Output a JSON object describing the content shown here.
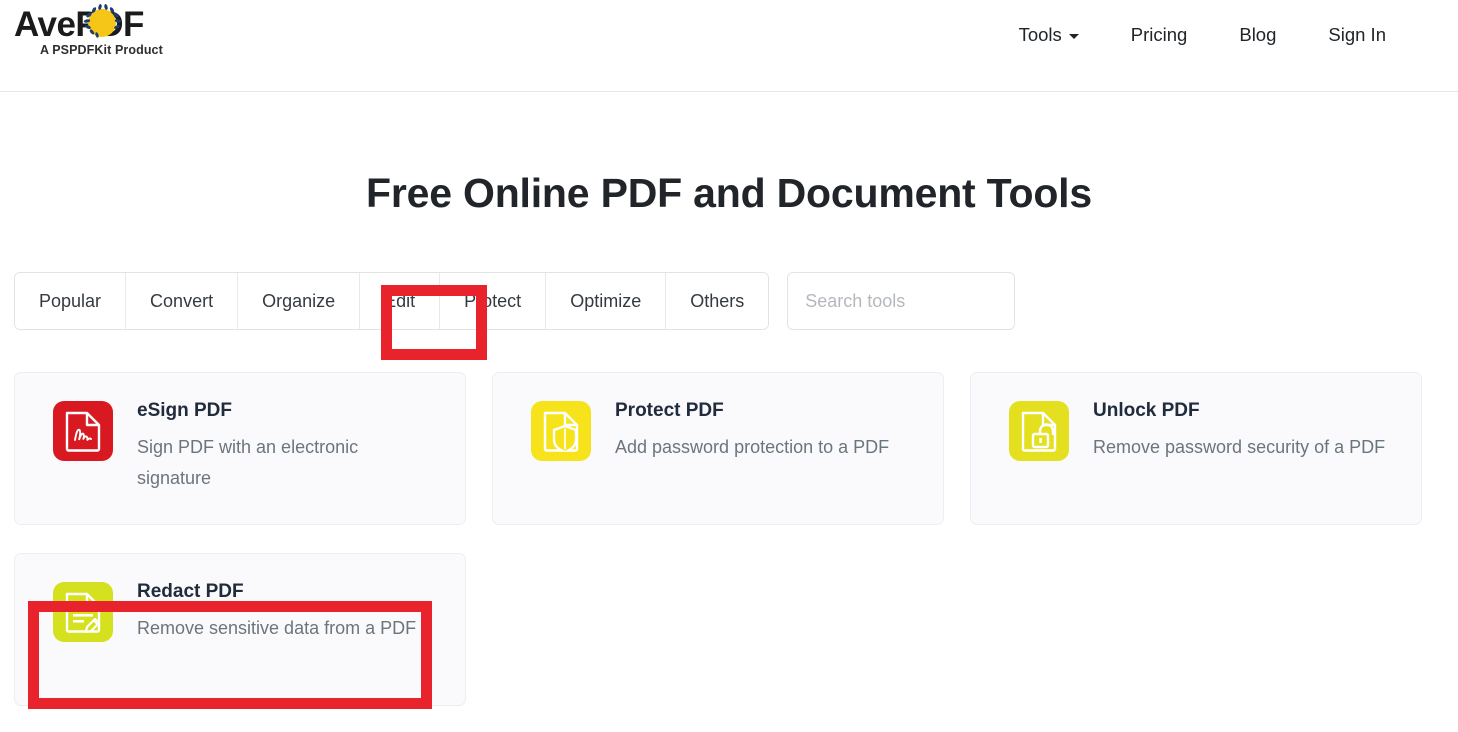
{
  "header": {
    "logo": {
      "text_ave": "Av",
      "text_e": "e",
      "text_pdf": "PDF",
      "tagline": "A PSPDFKit Product"
    },
    "nav": [
      {
        "label": "Tools",
        "has_dropdown": true
      },
      {
        "label": "Pricing",
        "has_dropdown": false
      },
      {
        "label": "Blog",
        "has_dropdown": false
      },
      {
        "label": "Sign In",
        "has_dropdown": false
      }
    ]
  },
  "main": {
    "title": "Free Online PDF and Document Tools",
    "tabs": [
      {
        "label": "Popular",
        "highlighted": false
      },
      {
        "label": "Convert",
        "highlighted": false
      },
      {
        "label": "Organize",
        "highlighted": false
      },
      {
        "label": "Edit",
        "highlighted": false
      },
      {
        "label": "Protect",
        "highlighted": true
      },
      {
        "label": "Optimize",
        "highlighted": false
      },
      {
        "label": "Others",
        "highlighted": false
      }
    ],
    "search": {
      "placeholder": "Search tools",
      "value": ""
    },
    "cards": [
      {
        "title": "eSign PDF",
        "description": "Sign PDF with an electronic signature",
        "icon": "document-signature-icon",
        "icon_bg": "#D81921",
        "highlighted": false
      },
      {
        "title": "Protect PDF",
        "description": "Add password protection to a PDF",
        "icon": "document-shield-icon",
        "icon_bg": "#F6E31B",
        "highlighted": false
      },
      {
        "title": "Unlock PDF",
        "description": "Remove password security of a PDF",
        "icon": "document-unlock-icon",
        "icon_bg": "#E4E020",
        "highlighted": false
      },
      {
        "title": "Redact PDF",
        "description": "Remove sensitive data from a PDF",
        "icon": "document-redact-icon",
        "icon_bg": "#D5E01E",
        "highlighted": true
      }
    ]
  },
  "annotations": {
    "highlight_color": "#E8232B",
    "targets": [
      "Protect",
      "Redact PDF"
    ]
  }
}
